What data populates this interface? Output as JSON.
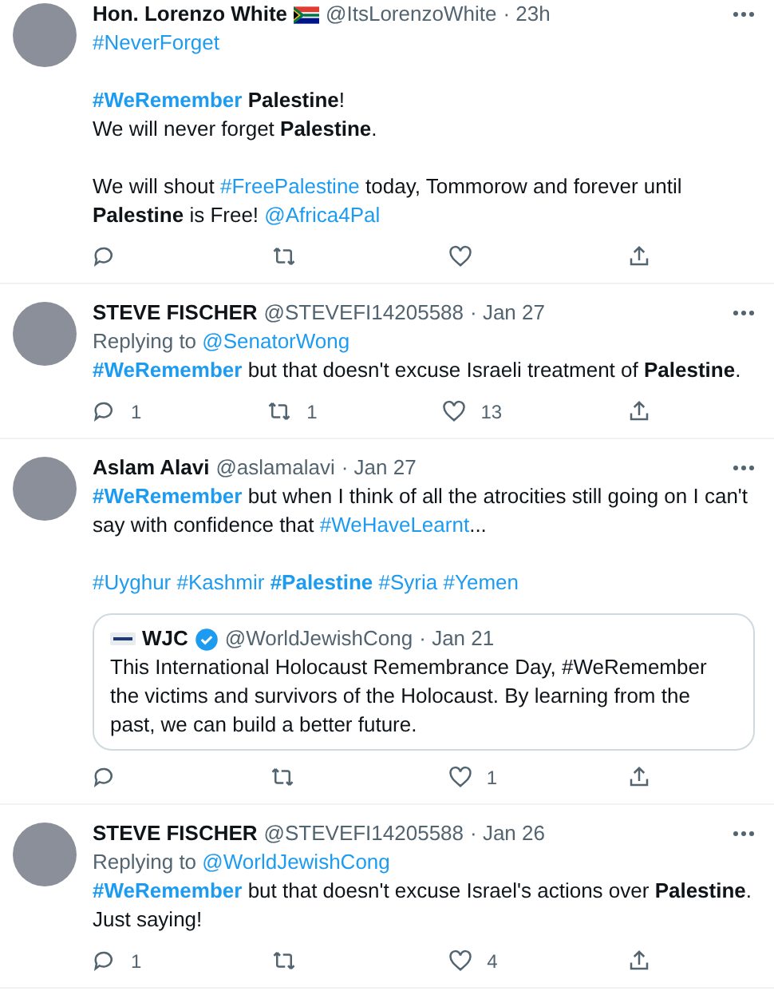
{
  "tweets": [
    {
      "name": "Hon. Lorenzo White",
      "flag": true,
      "handle": "@ItsLorenzoWhite",
      "time": "· 23h",
      "body": [
        [
          {
            "kind": "hashtag",
            "text": "#NeverForget"
          }
        ],
        [
          {
            "kind": "hashtag",
            "text": "**#WeRemember**"
          },
          {
            "kind": "text",
            "text": " **Palestine**!\nWe will never forget **Palestine**."
          }
        ],
        [
          {
            "kind": "text",
            "text": "We will shout "
          },
          {
            "kind": "hashtag",
            "text": "#FreePalestine"
          },
          {
            "kind": "text",
            "text": " today, Tommorow and forever until **Palestine** is Free! "
          },
          {
            "kind": "mention",
            "text": "@Africa4Pal"
          }
        ]
      ],
      "actions": [
        {
          "kind": "reply"
        },
        {
          "kind": "retweet"
        },
        {
          "kind": "like"
        },
        {
          "kind": "share"
        }
      ]
    },
    {
      "name": "STEVE FISCHER",
      "handle": "@STEVEFI14205588",
      "time": "· Jan 27",
      "replying_label": "Replying to",
      "replying_to": "@SenatorWong",
      "body": [
        [
          {
            "kind": "hashtag",
            "text": "**#WeRemember**"
          },
          {
            "kind": "text",
            "text": " but that doesn't excuse Israeli treatment of **Palestine**."
          }
        ]
      ],
      "actions": [
        {
          "kind": "reply",
          "count": "1"
        },
        {
          "kind": "retweet",
          "count": "1"
        },
        {
          "kind": "like",
          "count": "13"
        },
        {
          "kind": "share"
        }
      ]
    },
    {
      "name": "Aslam Alavi",
      "handle": "@aslamalavi",
      "time": "· Jan 27",
      "body": [
        [
          {
            "kind": "hashtag",
            "text": "**#WeRemember**"
          },
          {
            "kind": "text",
            "text": " but when I think of all the atrocities still going on I can't say with confidence that "
          },
          {
            "kind": "hashtag",
            "text": "#WeHaveLearnt"
          },
          {
            "kind": "text",
            "text": "..."
          }
        ],
        [
          {
            "kind": "hashtag",
            "text": "#Uyghur"
          },
          {
            "kind": "hashtag",
            "text": "#Kashmir"
          },
          {
            "kind": "hashtag",
            "text": "**#Palestine**"
          },
          {
            "kind": "hashtag",
            "text": "#Syria"
          },
          {
            "kind": "hashtag",
            "text": "#Yemen"
          }
        ]
      ],
      "quote": {
        "name": "WJC",
        "verified": true,
        "handle": "@WorldJewishCong",
        "time": "· Jan 21",
        "text": "This International Holocaust Remembrance Day, #WeRemember the victims and survivors of the Holocaust. By learning from the past, we can build a better future."
      },
      "actions": [
        {
          "kind": "reply"
        },
        {
          "kind": "retweet"
        },
        {
          "kind": "like",
          "count": "1"
        },
        {
          "kind": "share"
        }
      ]
    },
    {
      "name": "STEVE FISCHER",
      "handle": "@STEVEFI14205588",
      "time": "· Jan 26",
      "replying_label": "Replying to",
      "replying_to": "@WorldJewishCong",
      "body": [
        [
          {
            "kind": "hashtag",
            "text": "**#WeRemember**"
          },
          {
            "kind": "text",
            "text": " but that doesn't excuse Israel's actions over **Palestine**.\nJust saying!"
          }
        ]
      ],
      "actions": [
        {
          "kind": "reply",
          "count": "1"
        },
        {
          "kind": "retweet"
        },
        {
          "kind": "like",
          "count": "4"
        },
        {
          "kind": "share"
        }
      ]
    }
  ]
}
